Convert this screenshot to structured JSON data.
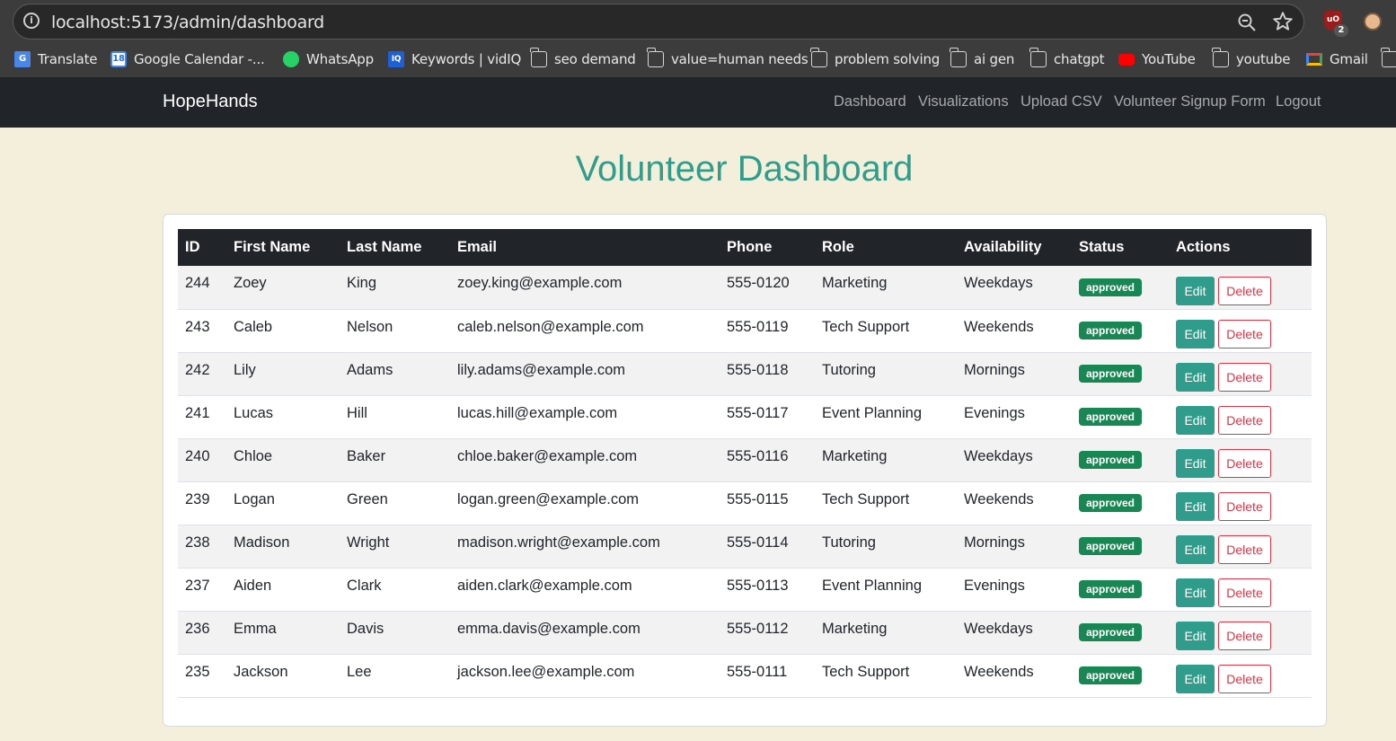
{
  "browser": {
    "url": "localhost:5173/admin/dashboard",
    "extension_badge": "2",
    "extension_label": "uO",
    "bookmarks": [
      {
        "label": "Translate",
        "icon": "google-translate-icon"
      },
      {
        "label": "Google Calendar -...",
        "icon": "google-calendar-icon",
        "icon_text": "18"
      },
      {
        "label": "WhatsApp",
        "icon": "whatsapp-icon"
      },
      {
        "label": "Keywords | vidIQ",
        "icon": "vidiq-icon",
        "icon_text": "IQ"
      },
      {
        "label": "seo demand",
        "icon": "folder-icon"
      },
      {
        "label": "value=human needs",
        "icon": "folder-icon"
      },
      {
        "label": "problem solving",
        "icon": "folder-icon"
      },
      {
        "label": "ai gen",
        "icon": "folder-icon"
      },
      {
        "label": "chatgpt",
        "icon": "folder-icon"
      },
      {
        "label": "YouTube",
        "icon": "youtube-icon"
      },
      {
        "label": "youtube",
        "icon": "folder-icon"
      },
      {
        "label": "Gmail",
        "icon": "gmail-icon"
      }
    ]
  },
  "navbar": {
    "brand": "HopeHands",
    "links": [
      "Dashboard",
      "Visualizations",
      "Upload CSV",
      "Volunteer Signup Form",
      "Logout"
    ]
  },
  "page": {
    "title": "Volunteer Dashboard"
  },
  "table": {
    "headers": [
      "ID",
      "First Name",
      "Last Name",
      "Email",
      "Phone",
      "Role",
      "Availability",
      "Status",
      "Actions"
    ],
    "edit_label": "Edit",
    "delete_label": "Delete",
    "rows": [
      {
        "id": "244",
        "first": "Zoey",
        "last": "King",
        "email": "zoey.king@example.com",
        "phone": "555-0120",
        "role": "Marketing",
        "availability": "Weekdays",
        "status": "approved"
      },
      {
        "id": "243",
        "first": "Caleb",
        "last": "Nelson",
        "email": "caleb.nelson@example.com",
        "phone": "555-0119",
        "role": "Tech Support",
        "availability": "Weekends",
        "status": "approved"
      },
      {
        "id": "242",
        "first": "Lily",
        "last": "Adams",
        "email": "lily.adams@example.com",
        "phone": "555-0118",
        "role": "Tutoring",
        "availability": "Mornings",
        "status": "approved"
      },
      {
        "id": "241",
        "first": "Lucas",
        "last": "Hill",
        "email": "lucas.hill@example.com",
        "phone": "555-0117",
        "role": "Event Planning",
        "availability": "Evenings",
        "status": "approved"
      },
      {
        "id": "240",
        "first": "Chloe",
        "last": "Baker",
        "email": "chloe.baker@example.com",
        "phone": "555-0116",
        "role": "Marketing",
        "availability": "Weekdays",
        "status": "approved"
      },
      {
        "id": "239",
        "first": "Logan",
        "last": "Green",
        "email": "logan.green@example.com",
        "phone": "555-0115",
        "role": "Tech Support",
        "availability": "Weekends",
        "status": "approved"
      },
      {
        "id": "238",
        "first": "Madison",
        "last": "Wright",
        "email": "madison.wright@example.com",
        "phone": "555-0114",
        "role": "Tutoring",
        "availability": "Mornings",
        "status": "approved"
      },
      {
        "id": "237",
        "first": "Aiden",
        "last": "Clark",
        "email": "aiden.clark@example.com",
        "phone": "555-0113",
        "role": "Event Planning",
        "availability": "Evenings",
        "status": "approved"
      },
      {
        "id": "236",
        "first": "Emma",
        "last": "Davis",
        "email": "emma.davis@example.com",
        "phone": "555-0112",
        "role": "Marketing",
        "availability": "Weekdays",
        "status": "approved"
      },
      {
        "id": "235",
        "first": "Jackson",
        "last": "Lee",
        "email": "jackson.lee@example.com",
        "phone": "555-0111",
        "role": "Tech Support",
        "availability": "Weekends",
        "status": "approved"
      }
    ]
  },
  "colors": {
    "page_bg": "#f3efdb",
    "navbar_bg": "#212529",
    "title_teal": "#2f9c8c",
    "badge_green": "#198754",
    "delete_red": "#dc3545"
  }
}
